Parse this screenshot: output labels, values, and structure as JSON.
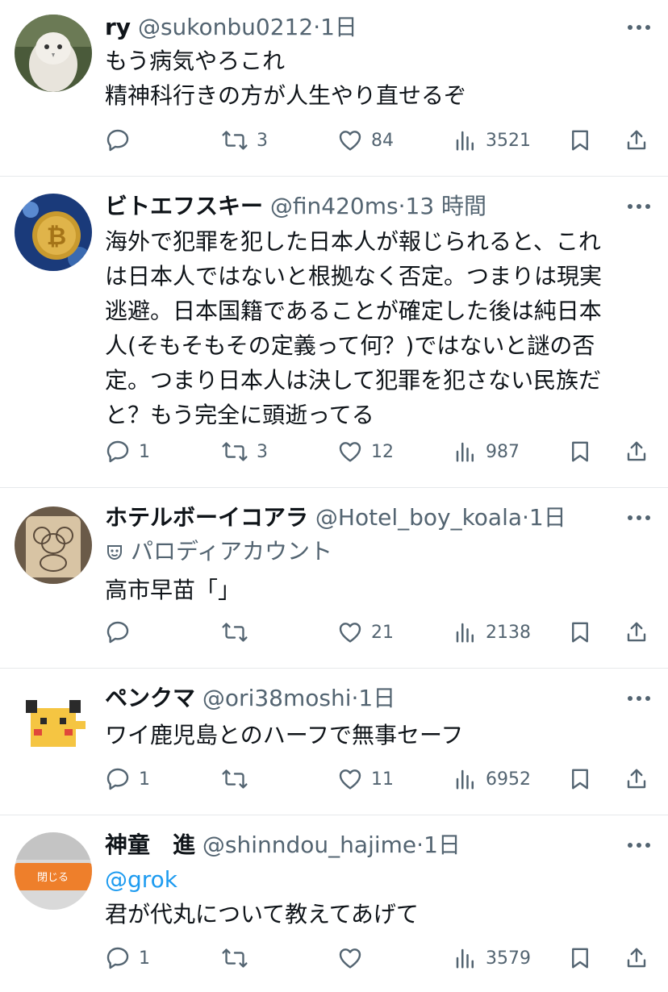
{
  "tweets": [
    {
      "name": "ry",
      "handle": "@sukonbu0212",
      "dot": "·",
      "time": "1日",
      "lines": [
        "もう病気やろこれ",
        "精神科行きの方が人生やり直せるぞ"
      ],
      "replies": "",
      "retweets": "3",
      "likes": "84",
      "views": "3521"
    },
    {
      "name": "ビトエフスキー",
      "handle": "@fin420ms",
      "dot": "·",
      "time": "13 時間",
      "lines": [
        "海外で犯罪を犯した日本人が報じられると、これ",
        "は日本人ではないと根拠なく否定。つまりは現実",
        "逃避。日本国籍であることが確定した後は純日本",
        "人(そもそもその定義って何？)ではないと謎の否",
        "定。つまり日本人は決して犯罪を犯さない民族だ",
        "と？もう完全に頭逝ってる"
      ],
      "replies": "1",
      "retweets": "3",
      "likes": "12",
      "views": "987"
    },
    {
      "name": "ホテルボーイコアラ",
      "handle": "@Hotel_boy_koala",
      "dot": "·",
      "time": "1日",
      "parody": "パロディアカウント",
      "lines": [
        "高市早苗「」"
      ],
      "replies": "",
      "retweets": "",
      "likes": "21",
      "views": "2138"
    },
    {
      "name": "ペンクマ",
      "handle": "@ori38moshi",
      "dot": "·",
      "time": "1日",
      "lines": [
        "ワイ鹿児島とのハーフで無事セーフ"
      ],
      "replies": "1",
      "retweets": "",
      "likes": "11",
      "views": "6952"
    },
    {
      "name": "神童　進",
      "handle": "@shinndou_hajime",
      "dot": "·",
      "time": "1日",
      "mention": "@grok",
      "avatar_text": "閉じる",
      "lines": [
        "君が代丸について教えてあげて"
      ],
      "replies": "1",
      "retweets": "",
      "likes": "",
      "views": "3579"
    }
  ],
  "icons": {
    "reply": "reply-icon",
    "retweet": "retweet-icon",
    "like": "heart-icon",
    "views": "views-icon",
    "bookmark": "bookmark-icon",
    "share": "share-icon",
    "more": "more-icon",
    "parody": "parody-mask-icon"
  },
  "colors": {
    "text": "#0f1419",
    "secondary": "#536471",
    "link": "#1d9bf0",
    "divider": "#e6e9eb"
  }
}
